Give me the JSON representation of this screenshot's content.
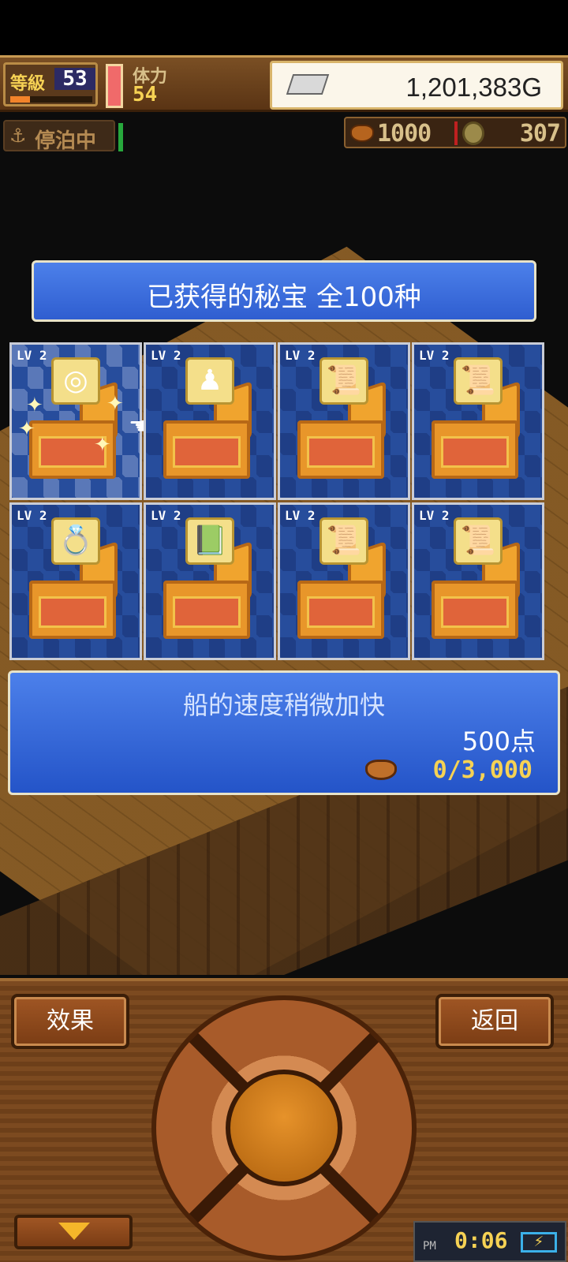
{
  "hud": {
    "level_label": "等級",
    "level_value": "53",
    "stamina_label": "体力",
    "stamina_value": "54",
    "gold_value": "1,201,383G",
    "docked_label": "停泊中",
    "pot_value": "1000",
    "coin_value": "307"
  },
  "treasure_panel": {
    "title": "已获得的秘宝 全100种",
    "cards": [
      {
        "level": "LV 2",
        "item_icon": "ring-icon",
        "glyph": "◎",
        "selected": true
      },
      {
        "level": "LV 2",
        "item_icon": "statue-icon",
        "glyph": "♟",
        "selected": false
      },
      {
        "level": "LV 2",
        "item_icon": "scroll-icon",
        "glyph": "📜",
        "selected": false
      },
      {
        "level": "LV 2",
        "item_icon": "scroll-icon",
        "glyph": "📜",
        "selected": false
      },
      {
        "level": "LV 2",
        "item_icon": "gem-ring-icon",
        "glyph": "💍",
        "selected": false
      },
      {
        "level": "LV 2",
        "item_icon": "green-book-icon",
        "glyph": "📗",
        "selected": false
      },
      {
        "level": "LV 2",
        "item_icon": "scroll-icon",
        "glyph": "📜",
        "selected": false
      },
      {
        "level": "LV 2",
        "item_icon": "scroll-icon",
        "glyph": "📜",
        "selected": false
      }
    ],
    "description": "船的速度稍微加快",
    "points": "500点",
    "progress": "0/3,000"
  },
  "controls": {
    "effect_label": "效果",
    "back_label": "返回",
    "clock_ampm": "PM",
    "clock_time": "0:06"
  },
  "colors": {
    "panel_blue": "#3c6fd8",
    "card_blue": "#1f3e86",
    "wood": "#7c4a20",
    "gold_text": "#f6d254"
  }
}
